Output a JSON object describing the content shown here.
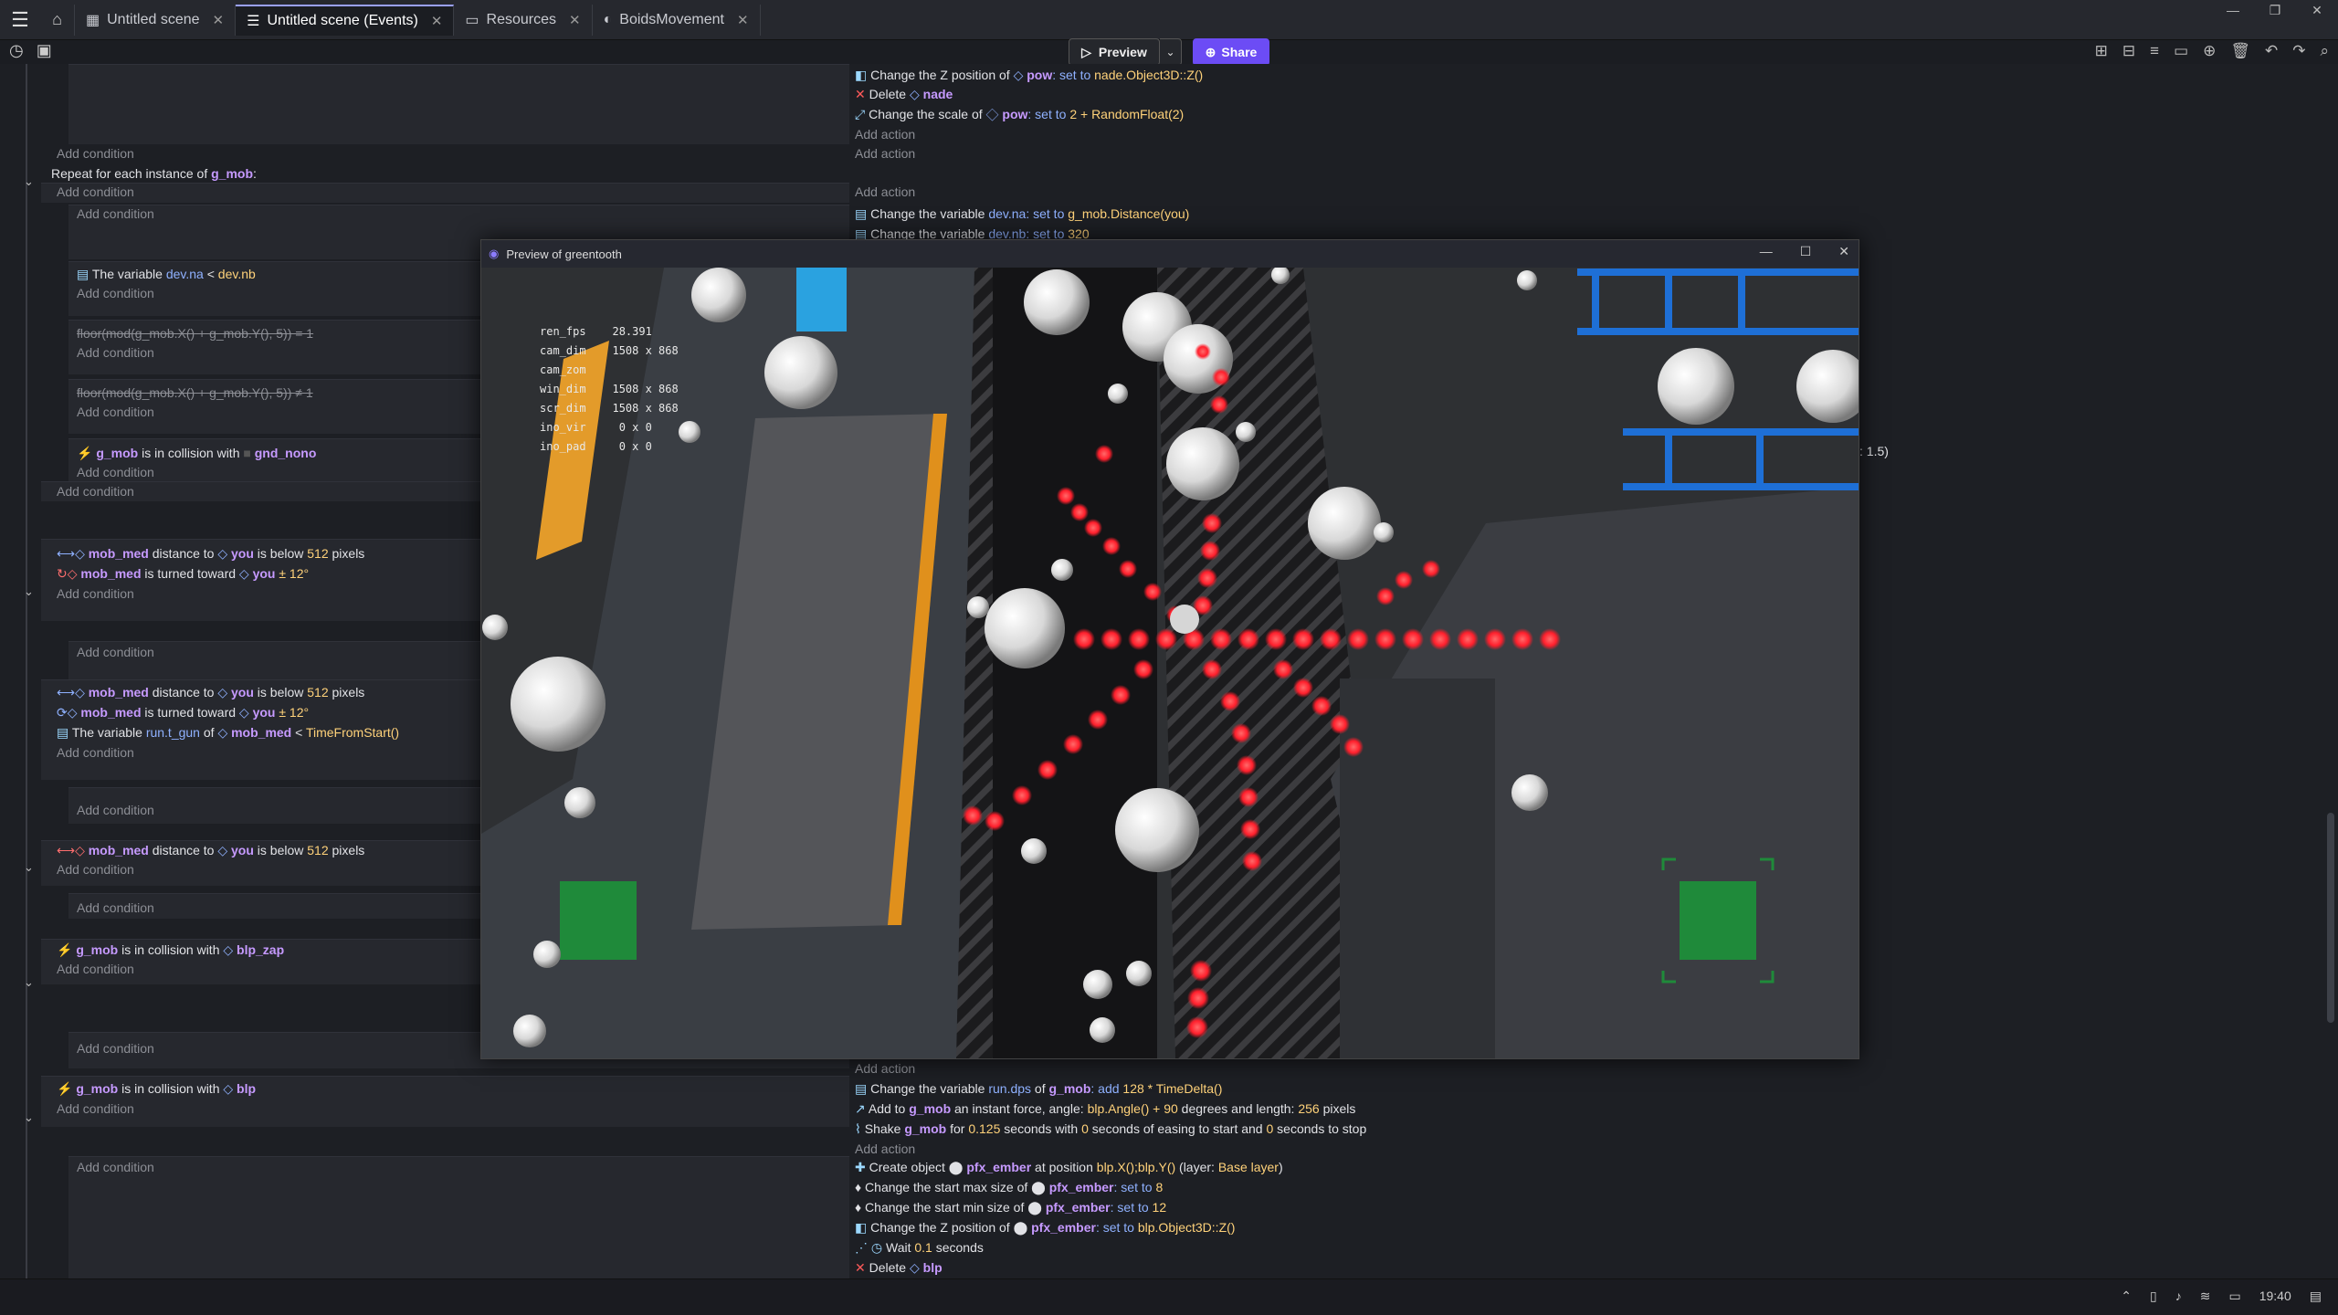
{
  "tabs": [
    {
      "label": "Untitled scene",
      "active": false
    },
    {
      "label": "Untitled scene (Events)",
      "active": true
    },
    {
      "label": "Resources",
      "active": false
    },
    {
      "label": "BoidsMovement",
      "active": false
    }
  ],
  "toolbar": {
    "preview_label": "Preview",
    "share_label": "Share"
  },
  "events": {
    "top_actions": [
      {
        "icon": "3d",
        "text": "Change the Z position of ",
        "obj": "pow",
        "rest": ": set to ",
        "val": "nade.Object3D::Z()"
      },
      {
        "icon": "delete",
        "text": "Delete ",
        "obj": "nade",
        "rest": "",
        "val": ""
      },
      {
        "icon": "scale",
        "text": "Change the scale of ",
        "obj": "pow",
        "rest": ": set to ",
        "val": "2 + RandomFloat(2)"
      }
    ],
    "add_action": "Add action",
    "add_condition": "Add condition",
    "repeat_label": "Repeat for each instance of ",
    "repeat_obj": "g_mob",
    "repeat_suffix": ":",
    "mid_actions": [
      {
        "text": "Change the variable ",
        "var": "dev.na",
        "rest": ": set to ",
        "val": "g_mob.Distance(you)"
      },
      {
        "text": "Change the variable ",
        "var": "dev.nb",
        "rest": ": set to ",
        "val": "320"
      }
    ],
    "cond_var": {
      "text": "The variable ",
      "var": "dev.na",
      "op": " < ",
      "val": "dev.nb"
    },
    "cond_floor1": "floor(mod(g_mob.X() + g_mob.Y(), 5)) = 1",
    "cond_floor2": "floor(mod(g_mob.X() + g_mob.Y(), 5)) ≠ 1",
    "cond_collision_gnd": {
      "obj": "g_mob",
      "text": " is in collision with ",
      "target": "gnd_nono"
    },
    "cond_dist1": {
      "obj": "mob_med",
      "text": " distance to ",
      "target": "you",
      "mid": " is below ",
      "val": "512",
      "unit": " pixels"
    },
    "cond_turn1": {
      "obj": "mob_med",
      "text": " is turned toward ",
      "target": "you",
      "val": " ± 12°"
    },
    "cond_dist2": {
      "obj": "mob_med",
      "text": " distance to ",
      "target": "you",
      "mid": " is below ",
      "val": "512",
      "unit": " pixels"
    },
    "cond_turn2": {
      "obj": "mob_med",
      "text": " is turned toward ",
      "target": "you",
      "val": " ± 12°"
    },
    "cond_var2": {
      "text": "The variable ",
      "var": "run.t_gun",
      "mid": " of ",
      "obj": "mob_med",
      "op": " < ",
      "val": "TimeFromStart()"
    },
    "cond_dist3": {
      "obj": "mob_med",
      "text": " distance to ",
      "target": "you",
      "mid": " is below ",
      "val": "512",
      "unit": " pixels"
    },
    "cond_blp_zap": {
      "obj": "g_mob",
      "text": " is in collision with ",
      "target": "blp_zap"
    },
    "cond_blp": {
      "obj": "g_mob",
      "text": " is in collision with ",
      "target": "blp"
    },
    "right_clip": ": 1.5)",
    "bottom_actions1": [
      {
        "text": "Change the variable ",
        "var": "run.dps",
        "mid": " of ",
        "obj": "g_mob",
        "rest": ": add ",
        "val": "128 * TimeDelta()"
      },
      {
        "text": "Add to ",
        "obj": "g_mob",
        "rest": " an instant force, angle: ",
        "val": "blp.Angle() + 90",
        "rest2": " degrees and length: ",
        "val2": "256",
        "rest3": " pixels"
      },
      {
        "text": "Shake ",
        "obj": "g_mob",
        "rest": " for ",
        "val": "0.125",
        "rest2": " seconds with ",
        "val2": "0",
        "rest3": " seconds of easing to start and ",
        "val3": "0",
        "rest4": " seconds to stop"
      }
    ],
    "bottom_actions2": [
      {
        "text": "Create object ",
        "obj": "pfx_ember",
        "rest": " at position ",
        "val": "blp.X();blp.Y()",
        "rest2": " (layer: ",
        "val2": "Base layer",
        "rest3": ")"
      },
      {
        "text": "Change the start max size of ",
        "obj": "pfx_ember",
        "rest": ": set to ",
        "val": "8"
      },
      {
        "text": "Change the start min size of ",
        "obj": "pfx_ember",
        "rest": ": set to ",
        "val": "12"
      },
      {
        "text": "Change the Z position of ",
        "obj": "pfx_ember",
        "rest": ": set to ",
        "val": "blp.Object3D::Z()"
      },
      {
        "text": "Wait ",
        "val": "0.1",
        "rest": " seconds"
      },
      {
        "text": "Delete ",
        "obj": "blp"
      }
    ]
  },
  "preview": {
    "title": "Preview of greentooth",
    "debug_lines": [
      "ren_fps    28.391",
      "cam_dim    1508 x 868",
      "cam_zom",
      "win_dim    1508 x 868",
      "scr_dim    1508 x 868",
      "ino_vir     0 x 0",
      "ino_pad     0 x 0"
    ]
  },
  "status": {
    "time": "19:40"
  },
  "colors": {
    "accent": "#6c4cf5",
    "red_bullet": "#ff2a2a",
    "green_marker": "#1f8a3a"
  }
}
